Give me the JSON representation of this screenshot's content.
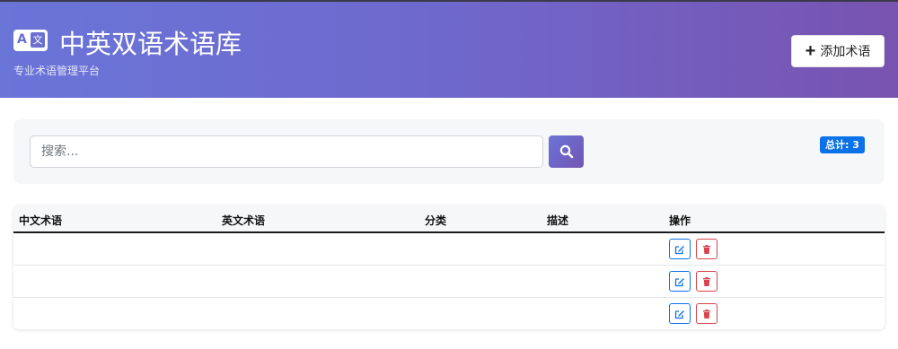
{
  "header": {
    "title": "中英双语术语库",
    "subtitle": "专业术语管理平台",
    "logo_letter": "A",
    "logo_glyph": "文",
    "add_button_label": "添加术语",
    "gradient_start": "#6a75d8",
    "gradient_end": "#7853b0"
  },
  "search": {
    "placeholder": "搜索...",
    "value": "",
    "total_label": "总计: 3"
  },
  "table": {
    "columns": [
      "中文术语",
      "英文术语",
      "分类",
      "描述",
      "操作"
    ],
    "rows": [
      {
        "zh": "",
        "en": "",
        "category": "",
        "description": ""
      },
      {
        "zh": "",
        "en": "",
        "category": "",
        "description": ""
      },
      {
        "zh": "",
        "en": "",
        "category": "",
        "description": ""
      }
    ]
  },
  "colors": {
    "accent": "#0b72e8",
    "danger": "#d9434f"
  },
  "icons": {
    "logo": "translate-icon",
    "add": "plus-icon",
    "search": "search-icon",
    "edit": "edit-icon",
    "delete": "trash-icon"
  }
}
